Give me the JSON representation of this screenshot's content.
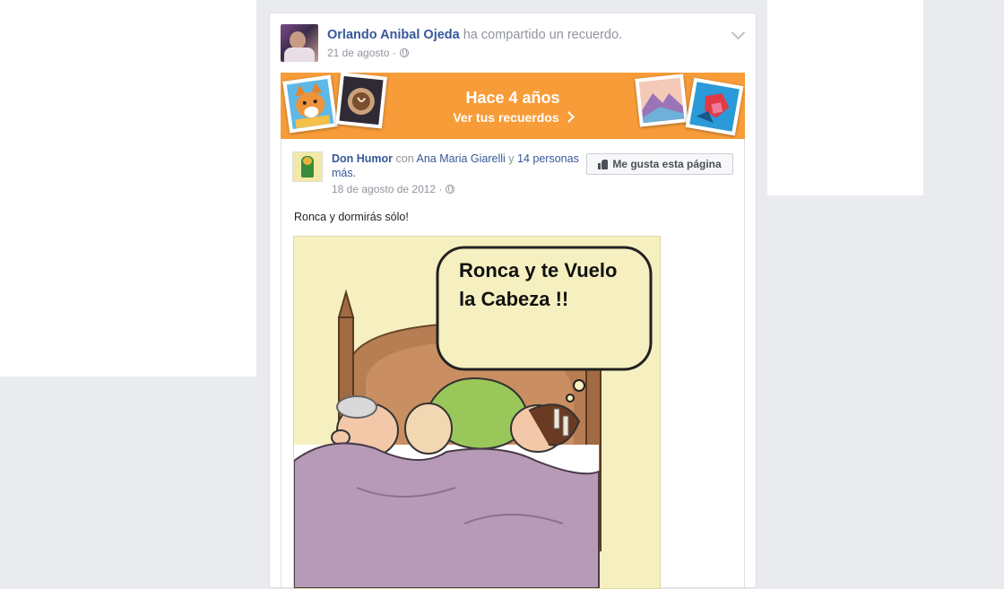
{
  "post": {
    "author": "Orlando Anibal Ojeda",
    "action": " ha compartido un recuerdo.",
    "date": "21 de agosto ·"
  },
  "memory_banner": {
    "title": "Hace 4 años",
    "link": "Ver tus recuerdos"
  },
  "shared_post": {
    "page_name": "Don Humor",
    "with_text": " con ",
    "tagged_person": "Ana Maria Giarelli",
    "and_text": " y ",
    "others": "14 personas más.",
    "date": "18 de agosto de 2012 ·",
    "like_page_label": "Me gusta esta página",
    "text": "Ronca y dormirás sólo!",
    "image_caption_line1": "Ronca y te Vuelo",
    "image_caption_line2": "la Cabeza !!"
  },
  "colors": {
    "banner": "#f79c38",
    "link": "#365899",
    "background": "#e9ebee"
  }
}
